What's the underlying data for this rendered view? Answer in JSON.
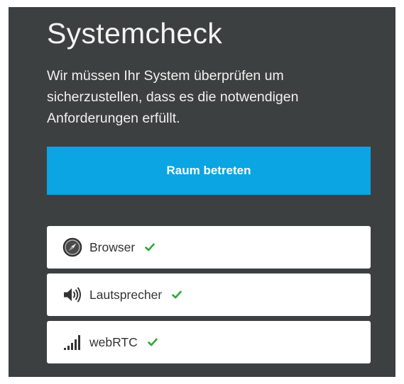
{
  "page": {
    "title": "Systemcheck",
    "description": "Wir müssen Ihr System überprüfen um sicherzustellen, dass es die notwendigen Anforderungen erfüllt."
  },
  "actions": {
    "join_label": "Raum betreten"
  },
  "checks": [
    {
      "label": "Browser",
      "icon": "compass-icon",
      "status": "ok"
    },
    {
      "label": "Lautsprecher",
      "icon": "speaker-icon",
      "status": "ok"
    },
    {
      "label": "webRTC",
      "icon": "signal-bars-icon",
      "status": "ok"
    }
  ],
  "colors": {
    "panel_background": "#3d4040",
    "accent": "#0aa5e2",
    "success": "#2ea83a",
    "text_light": "#f4f4f4"
  }
}
